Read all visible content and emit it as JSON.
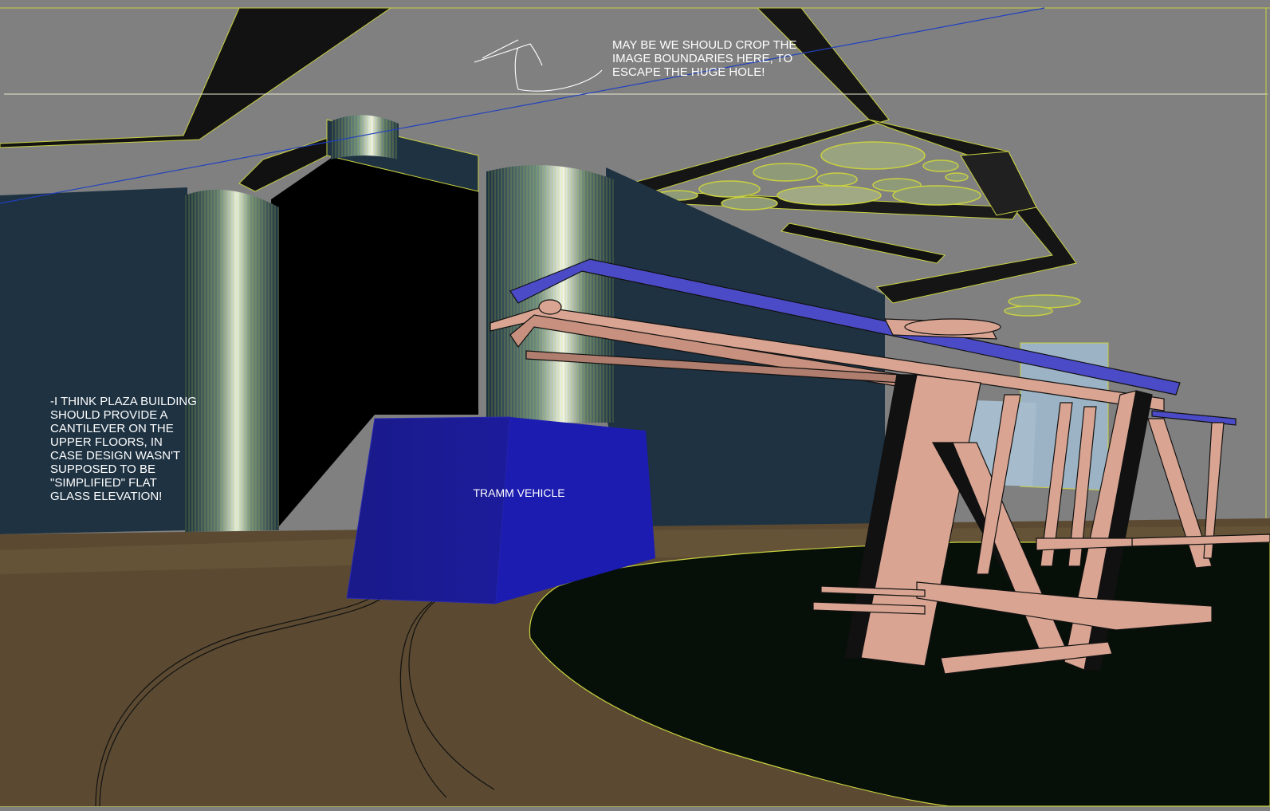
{
  "notes": {
    "crop_note": "MAY BE WE SHOULD CROP THE\nIMAGE BOUNDARIES HERE, TO\nESCAPE THE HUGE HOLE!",
    "cantilever_note": "-I THINK PLAZA BUILDING\nSHOULD PROVIDE A\nCANTILEVER ON THE\nUPPER FLOORS, IN\nCASE DESIGN WASN'T\nSUPPOSED TO BE\n\"SIMPLIFIED\" FLAT\nGLASS ELEVATION!",
    "tram_label": "TRAMM VEHICLE"
  },
  "colors": {
    "background": "#808080",
    "building": "#1e3242",
    "ground": "#5b4a31",
    "plaza": "#071008",
    "tram": "#1a1aa0",
    "structure": "#d9a592",
    "wire": "#c8d040",
    "guide_line": "#2040c0"
  }
}
